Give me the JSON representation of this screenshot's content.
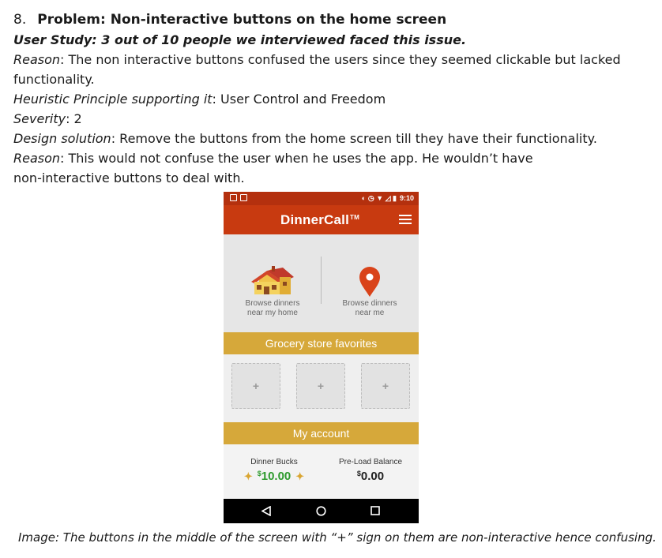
{
  "heading": {
    "number": "8.",
    "title": "Problem: Non-interactive buttons on the home screen"
  },
  "user_study": "User Study: 3 out of 10 people we interviewed faced this issue.",
  "reason1": {
    "label": "Reason",
    "text": ": The non interactive buttons confused the users since they seemed clickable but lacked functionality."
  },
  "heuristic": {
    "label": "Heuristic Principle supporting it",
    "text": ": User Control and Freedom"
  },
  "severity": {
    "label": "Severity",
    "text": ": 2"
  },
  "design": {
    "label": "Design solution",
    "text": ": Remove the buttons from the home screen till they have their functionality."
  },
  "reason2": {
    "label": "Reason",
    "text_line1": ": This would not confuse the user when he uses the app. He wouldn’t have",
    "text_line2": "non-interactive buttons to deal with."
  },
  "phone": {
    "status_time": "9:10",
    "brand": "DinnerCall",
    "brand_mark": "TM",
    "browse_home_line1": "Browse dinners",
    "browse_home_line2": "near my home",
    "browse_me_line1": "Browse dinners",
    "browse_me_line2": "near me",
    "grocery_band": "Grocery store favorites",
    "tile_plus": "+",
    "account_band": "My account",
    "dinner_bucks_label": "Dinner Bucks",
    "dinner_bucks_currency": "$",
    "dinner_bucks_value": "10.00",
    "preload_label": "Pre-Load Balance",
    "preload_currency": "$",
    "preload_value": "0.00",
    "colors": {
      "statusbar": "#b4300e",
      "appbar": "#c83a10",
      "band": "#d6a83a",
      "bucks_green": "#2e9a2e"
    },
    "icons": [
      "house-icon",
      "map-pin-icon",
      "back-icon",
      "home-circle-icon",
      "recents-square-icon",
      "hamburger-menu-icon"
    ]
  },
  "caption": "Image: The buttons in the middle of the screen with “+” sign on them are non-interactive hence confusing."
}
